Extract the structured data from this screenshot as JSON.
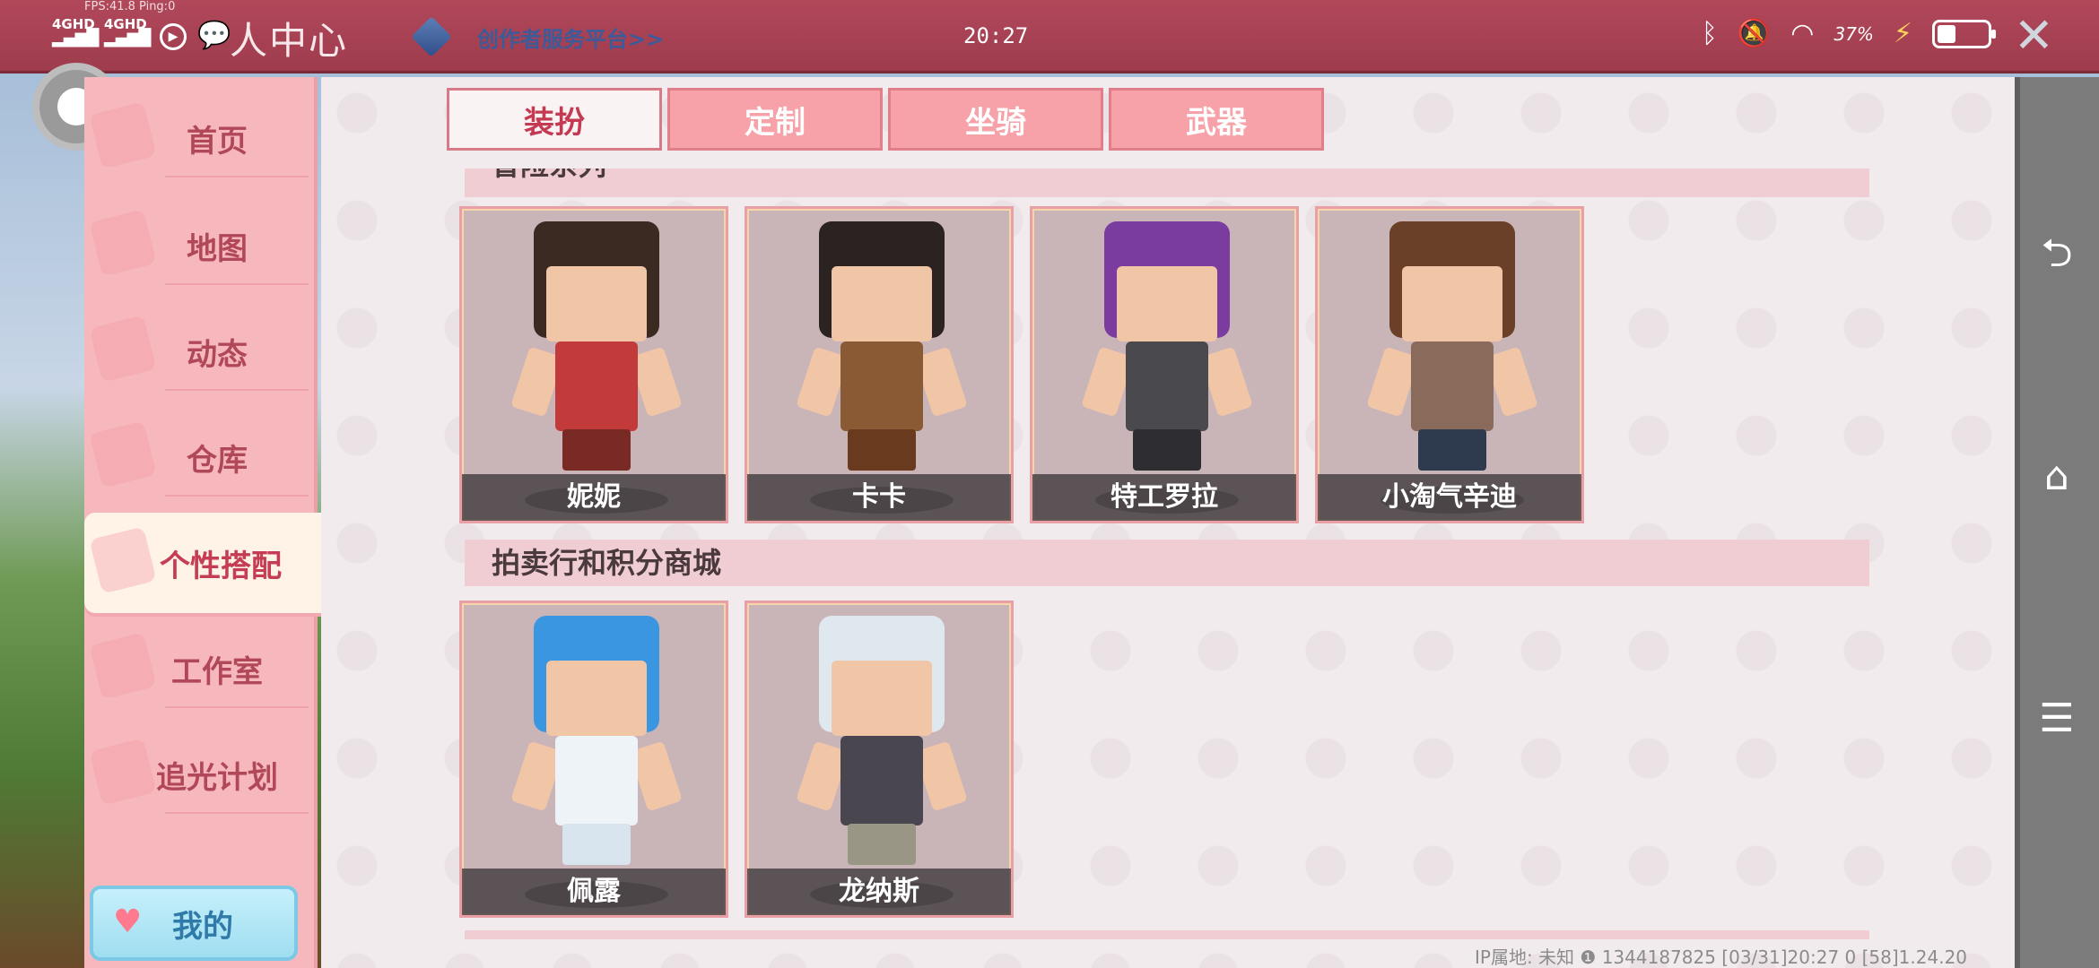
{
  "status_bar": {
    "fps": "FPS:41.8  Ping:0",
    "network1": "4GHD",
    "network2": "4GHD",
    "center_title": "人中心",
    "creator_link": "创作者服务平台>>",
    "time": "20:27",
    "battery_percent": "37%",
    "battery_level": 0.37
  },
  "sidebar": {
    "items": [
      {
        "label": "首页"
      },
      {
        "label": "地图"
      },
      {
        "label": "动态"
      },
      {
        "label": "仓库"
      },
      {
        "label": "个性搭配"
      },
      {
        "label": "工作室"
      },
      {
        "label": "追光计划"
      }
    ],
    "active_index": 4,
    "my_button": "我的"
  },
  "tabs": [
    {
      "label": "装扮"
    },
    {
      "label": "定制"
    },
    {
      "label": "坐骑"
    },
    {
      "label": "武器"
    }
  ],
  "sections": [
    {
      "title": "冒险系列",
      "items": [
        {
          "name": "妮妮",
          "hair": "#3b2a22",
          "outfit": "#c23a3a",
          "legs": "#7a2a24"
        },
        {
          "name": "卡卡",
          "hair": "#2b2321",
          "outfit": "#8a5a34",
          "legs": "#6a3a1e"
        },
        {
          "name": "特工罗拉",
          "hair": "#7a3c9e",
          "outfit": "#4a4a4e",
          "legs": "#2e2e32"
        },
        {
          "name": "小淘气辛迪",
          "hair": "#6a4128",
          "outfit": "#8a6a5a",
          "legs": "#2e3a4e"
        }
      ]
    },
    {
      "title": "拍卖行和积分商城",
      "items": [
        {
          "name": "佩露",
          "hair": "#3a96e0",
          "outfit": "#eef3f8",
          "legs": "#d8e4ee"
        },
        {
          "name": "龙纳斯",
          "hair": "#dfe7ef",
          "outfit": "#4a4650",
          "legs": "#9a9686"
        }
      ]
    }
  ],
  "footer": "IP属地: 未知 ❶  1344187825   [03/31]20:27 0  [58]1.24.20",
  "colors": {
    "accent": "#c33a52",
    "sidebar": "#f7b8bd",
    "status_bar": "#a84254"
  }
}
